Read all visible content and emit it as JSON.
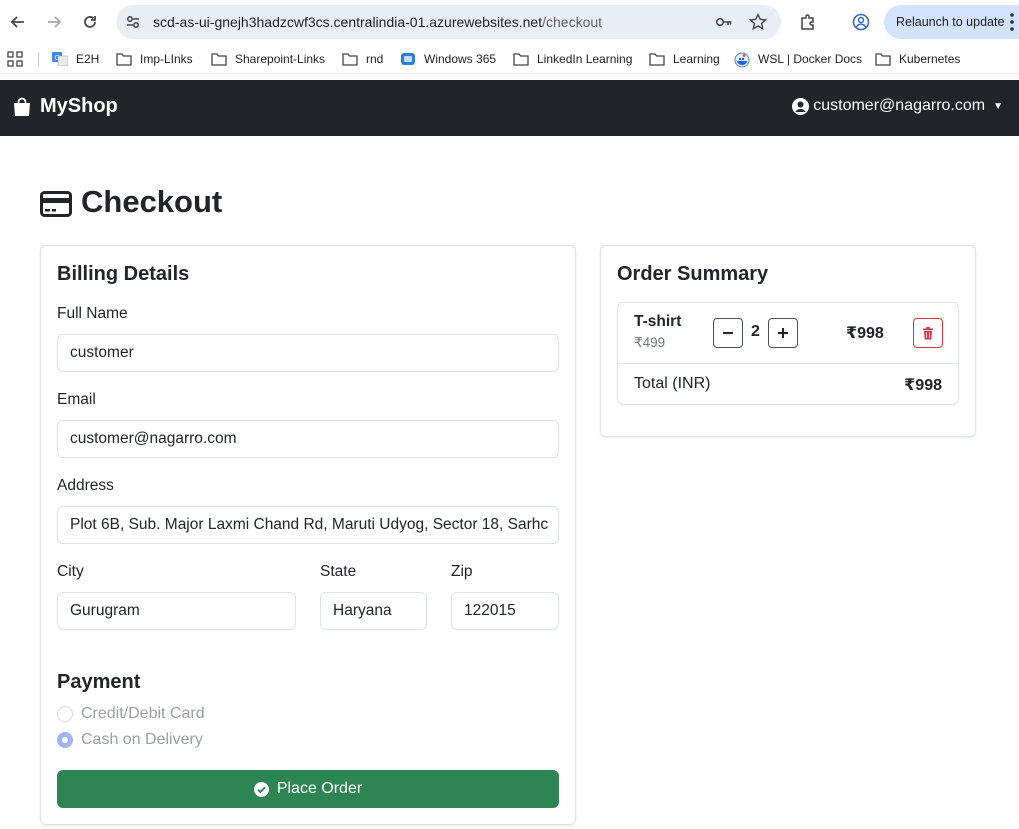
{
  "browser": {
    "url_host": "scd-as-ui-gnejh3hadzcwf3cs.centralindia-01.azurewebsites.net",
    "url_path": "/checkout",
    "relaunch_label": "Relaunch to update"
  },
  "bookmarks": [
    {
      "label": "E2H",
      "icon": "translate-icon"
    },
    {
      "label": "Imp-LInks",
      "icon": "folder-icon"
    },
    {
      "label": "Sharepoint-Links",
      "icon": "folder-icon"
    },
    {
      "label": "rnd",
      "icon": "folder-icon"
    },
    {
      "label": "Windows 365",
      "icon": "windows365-icon"
    },
    {
      "label": "LinkedIn Learning",
      "icon": "folder-icon"
    },
    {
      "label": "Learning",
      "icon": "folder-icon"
    },
    {
      "label": "WSL | Docker Docs",
      "icon": "docker-icon"
    },
    {
      "label": "Kubernetes",
      "icon": "folder-icon"
    }
  ],
  "navbar": {
    "brand": "MyShop",
    "user_email": "customer@nagarro.com"
  },
  "page": {
    "title": "Checkout"
  },
  "billing": {
    "heading": "Billing Details",
    "full_name_label": "Full Name",
    "full_name_value": "customer",
    "email_label": "Email",
    "email_value": "customer@nagarro.com",
    "address_label": "Address",
    "address_value": "Plot 6B, Sub. Major Laxmi Chand Rd, Maruti Udyog, Sector 18, Sarhc",
    "city_label": "City",
    "city_value": "Gurugram",
    "state_label": "State",
    "state_value": "Haryana",
    "zip_label": "Zip",
    "zip_value": "122015"
  },
  "payment": {
    "heading": "Payment",
    "options": [
      {
        "label": "Credit/Debit Card",
        "selected": false
      },
      {
        "label": "Cash on Delivery",
        "selected": true
      }
    ],
    "place_order_label": "Place Order"
  },
  "summary": {
    "heading": "Order Summary",
    "item": {
      "name": "T-shirt",
      "unit_price": "₹499",
      "quantity": "2",
      "line_total": "₹998"
    },
    "total_label": "Total (INR)",
    "total_value": "₹998"
  },
  "colors": {
    "navbar": "#212529",
    "success": "#2c8553",
    "danger": "#dc3545"
  }
}
